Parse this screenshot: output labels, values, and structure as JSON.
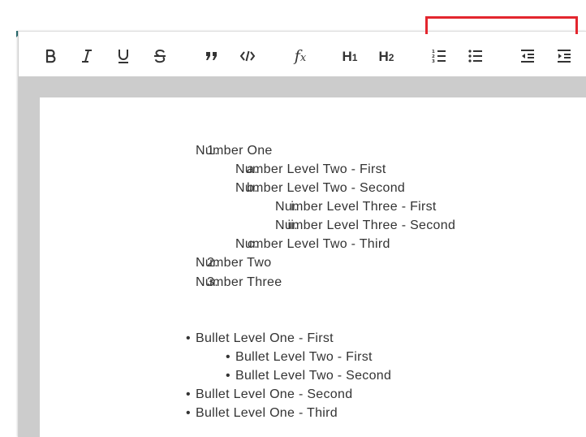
{
  "toolbar": {
    "buttons": [
      {
        "name": "bold",
        "icon": "bold-icon"
      },
      {
        "name": "italic",
        "icon": "italic-icon"
      },
      {
        "name": "underline",
        "icon": "underline-icon"
      },
      {
        "name": "strikethrough",
        "icon": "strikethrough-icon"
      },
      {
        "name": "blockquote",
        "icon": "quote-icon"
      },
      {
        "name": "code",
        "icon": "code-icon"
      },
      {
        "name": "formula",
        "icon": "formula-icon"
      },
      {
        "name": "heading-1",
        "icon": "h1-icon"
      },
      {
        "name": "heading-2",
        "icon": "h2-icon"
      },
      {
        "name": "ordered-list",
        "icon": "ordered-list-icon"
      },
      {
        "name": "bullet-list",
        "icon": "bullet-list-icon"
      },
      {
        "name": "outdent",
        "icon": "outdent-icon"
      },
      {
        "name": "indent",
        "icon": "indent-icon"
      }
    ]
  },
  "colors": {
    "highlight": "#e3262e",
    "canvas": "#cccccc",
    "text": "#333333",
    "corner": "#2a6f73"
  },
  "document": {
    "numbered_list": [
      {
        "marker": "1.",
        "text": "Number One",
        "level": 1
      },
      {
        "marker": "a.",
        "text": "Number Level Two - First",
        "level": 2
      },
      {
        "marker": "b.",
        "text": "Number Level Two - Second",
        "level": 2
      },
      {
        "marker": "i.",
        "text": "Number Level Three - First",
        "level": 3
      },
      {
        "marker": "ii.",
        "text": "Number Level Three - Second",
        "level": 3
      },
      {
        "marker": "c.",
        "text": "Number Level Two - Third",
        "level": 2
      },
      {
        "marker": "2.",
        "text": "Number Two",
        "level": 1
      },
      {
        "marker": "3.",
        "text": "Number Three",
        "level": 1
      }
    ],
    "bullet_list": [
      {
        "marker": "•",
        "text": "Bullet Level One - First",
        "level": 1
      },
      {
        "marker": "•",
        "text": "Bullet Level Two - First",
        "level": 2
      },
      {
        "marker": "•",
        "text": "Bullet Level Two - Second",
        "level": 2
      },
      {
        "marker": "•",
        "text": "Bullet Level One - Second",
        "level": 1
      },
      {
        "marker": "•",
        "text": "Bullet Level One - Third",
        "level": 1
      }
    ]
  }
}
